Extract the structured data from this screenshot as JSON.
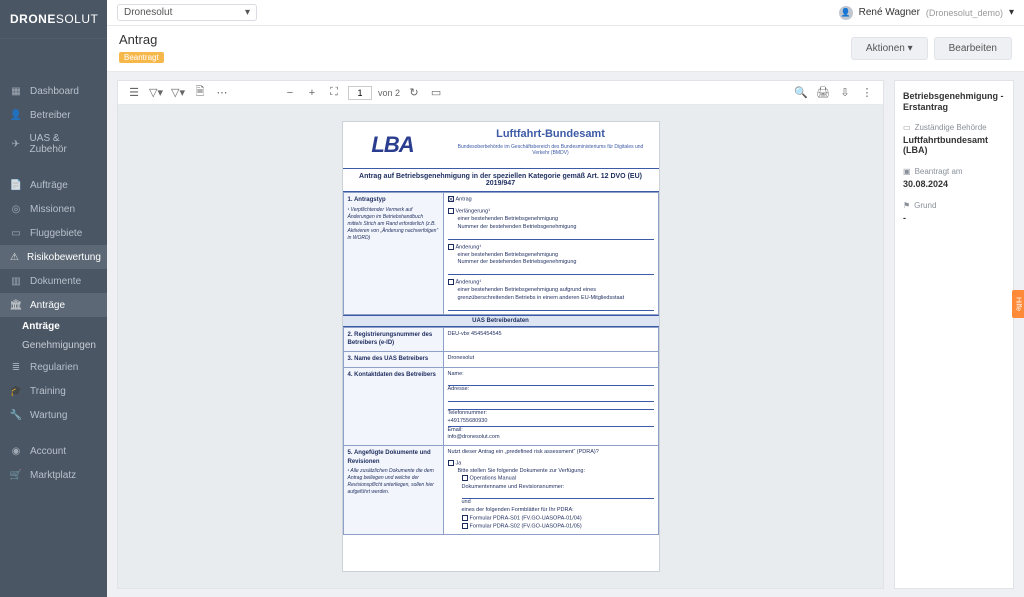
{
  "brand": {
    "part1": "DRONE",
    "part2": "SOLUT"
  },
  "workspace": "Dronesolut",
  "user": {
    "name": "René Wagner",
    "org": "(Dronesolut_demo)"
  },
  "header": {
    "title": "Antrag",
    "badge": "Beantragt",
    "actions_btn": "Aktionen ▾",
    "edit_btn": "Bearbeiten"
  },
  "nav": {
    "groups": [
      {
        "items": [
          {
            "icon": "▦",
            "label": "Dashboard"
          },
          {
            "icon": "👤",
            "label": "Betreiber"
          },
          {
            "icon": "✈",
            "label": "UAS & Zubehör"
          }
        ]
      },
      {
        "items": [
          {
            "icon": "📄",
            "label": "Aufträge"
          },
          {
            "icon": "◎",
            "label": "Missionen"
          },
          {
            "icon": "▭",
            "label": "Fluggebiete"
          },
          {
            "icon": "⚠",
            "label": "Risikobewertung",
            "selected": true
          },
          {
            "icon": "▥",
            "label": "Dokumente"
          },
          {
            "icon": "🏛",
            "label": "Anträge",
            "selected": true,
            "subs": [
              {
                "label": "Anträge",
                "active": true
              },
              {
                "label": "Genehmigungen"
              }
            ]
          },
          {
            "icon": "≣",
            "label": "Regularien"
          },
          {
            "icon": "🎓",
            "label": "Training"
          },
          {
            "icon": "🔧",
            "label": "Wartung"
          }
        ]
      },
      {
        "items": [
          {
            "icon": "◉",
            "label": "Account"
          },
          {
            "icon": "🛒",
            "label": "Marktplatz"
          }
        ]
      }
    ]
  },
  "pdf": {
    "toolbar": {
      "page": "1",
      "of": "von 2"
    },
    "logo": "LBA",
    "title": "Luftfahrt-Bundesamt",
    "subtitle": "Bundesoberbehörde im Geschäftsbereich des\nBundesministeriums für Digitales und Verkehr (BMDV)",
    "heading": "Antrag auf Betriebsgenehmigung in der speziellen Kategorie\ngemäß Art. 12 DVO (EU) 2019/947",
    "r1": {
      "t": "1. Antragstyp",
      "note": "¹ Verpflichtender Vermerk auf Änderungen im Betriebshandbuch mittels Strich am Rand erforderlich (z.B. Aktivieren von „Änderung nachverfolgen“ in WORD)",
      "opt_antrag": "Antrag",
      "opt_verl": "Verlängerung¹",
      "opt_verl_a": "einer bestehenden Betriebsgenehmigung",
      "opt_verl_b": "Nummer der bestehenden Betriebsgenehmigung",
      "opt_and": "Änderung¹",
      "opt_and_a": "einer bestehenden Betriebsgenehmigung",
      "opt_and_b": "Nummer der bestehenden Betriebsgenehmigung",
      "opt_and2": "Änderung¹",
      "opt_and2_a": "einer bestehenden Betriebsgenehmigung aufgrund eines grenzüberschreitenden Betriebs in einem anderen EU-Mitgliedsstaat"
    },
    "sec": "UAS Betreiberdaten",
    "r2": {
      "t": "2. Registrierungsnummer des Betreibers (e-ID)",
      "v": "DEU-vbx 4545454545"
    },
    "r3": {
      "t": "3. Name des UAS Betreibers",
      "v": "Dronesolut"
    },
    "r4": {
      "t": "4. Kontaktdaten des Betreibers",
      "name": "Name:",
      "adr": "Adresse:",
      "tel": "Telefonnummer:",
      "telv": "+491755680930",
      "email": "Email:",
      "emailv": "info@dronesolut.com"
    },
    "r5": {
      "t": "5. Angefügte Dokumente und Revisionen",
      "note": "¹ Alle zusätzlichen Dokumente die dem Antrag beiliegen und welche der Revisionspflicht unterliegen, sollen hier aufgeführt werden.",
      "q": "Nutzt dieser Antrag ein „predefined risk assessment“ (PDRA)?",
      "ja": "Ja",
      "inst": "Bitte stellen Sie folgende Dokumente zur Verfügung:",
      "om": "Operations Manual",
      "dn": "Dokumentenname und Revisionsnummer:",
      "und": "und",
      "fb": "eines der folgenden Formblätter für Ihr PDRA:",
      "f1": "Formular PDRA-S01   (FV.GO-UASOPA-01/04)",
      "f2": "Formular PDRA-S02   (FV.GO-UASOPA-01/05)"
    }
  },
  "side": {
    "title": "Betriebsgenehmigung - Erstantrag",
    "f1": {
      "l": "Zuständige Behörde",
      "v": "Luftfahrtbundesamt (LBA)"
    },
    "f2": {
      "l": "Beantragt am",
      "v": "30.08.2024"
    },
    "f3": {
      "l": "Grund",
      "v": "-"
    }
  },
  "help": "Hilfe"
}
